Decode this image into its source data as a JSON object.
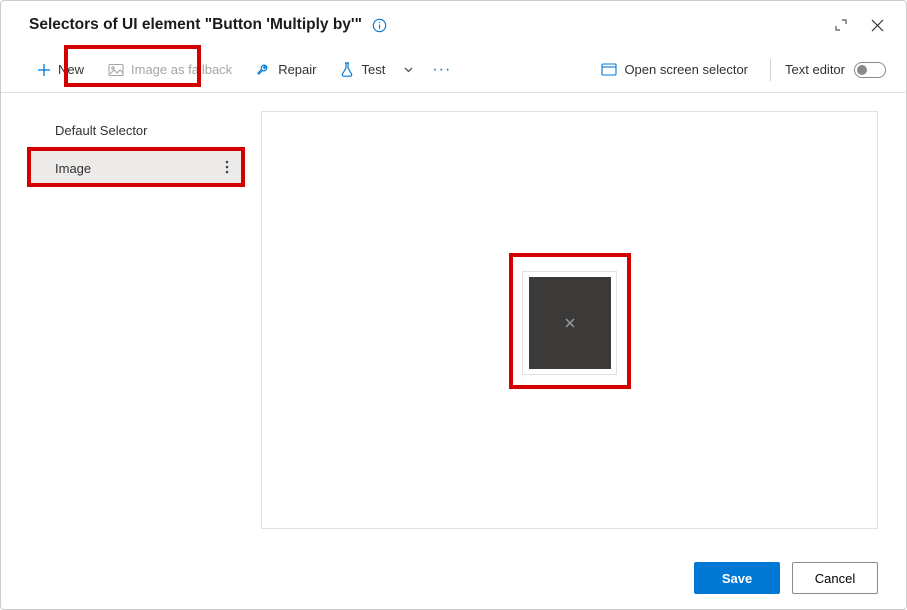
{
  "title": "Selectors of UI element \"Button 'Multiply by'\"",
  "toolbar": {
    "new_label": "New",
    "image_fallback_label": "Image as fallback",
    "repair_label": "Repair",
    "test_label": "Test",
    "open_screen_selector_label": "Open screen selector",
    "text_editor_label": "Text editor"
  },
  "sidebar": {
    "items": [
      {
        "label": "Default Selector"
      },
      {
        "label": "Image"
      }
    ],
    "selected_index": 1
  },
  "footer": {
    "save_label": "Save",
    "cancel_label": "Cancel"
  }
}
